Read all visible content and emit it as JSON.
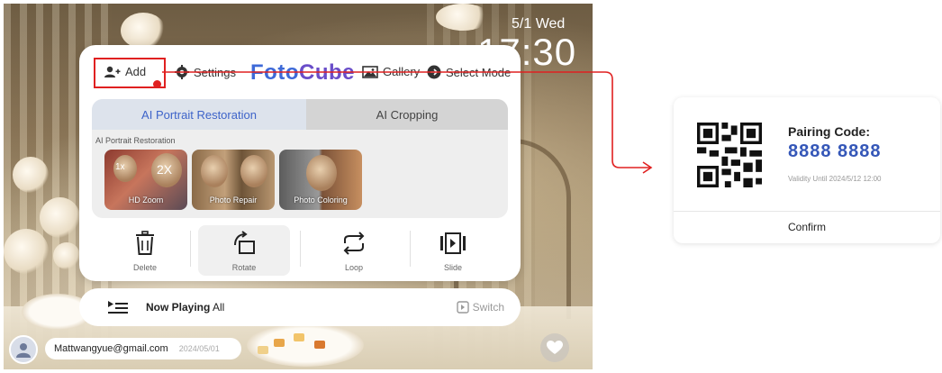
{
  "datetime": {
    "date": "5/1 Wed",
    "time": "17:30"
  },
  "nav": {
    "add_label": "Add",
    "settings_label": "Settings",
    "logo_part1": "Foto",
    "logo_part2": "Cube",
    "gallery_label": "Gallery",
    "select_mode_label": "Select Mode"
  },
  "tabs": [
    {
      "label": "AI Portrait Restoration",
      "active": true
    },
    {
      "label": "AI Cropping",
      "active": false
    }
  ],
  "section_label": "AI Portrait Restoration",
  "features": [
    {
      "label": "HD Zoom",
      "tag_a": "1x",
      "tag_b": "2X"
    },
    {
      "label": "Photo Repair"
    },
    {
      "label": "Photo Coloring"
    }
  ],
  "actions": [
    {
      "label": "Delete",
      "icon": "trash-icon"
    },
    {
      "label": "Rotate",
      "icon": "rotate-icon",
      "selected": true
    },
    {
      "label": "Loop",
      "icon": "loop-icon"
    },
    {
      "label": "Slide",
      "icon": "slide-icon"
    }
  ],
  "now_playing": {
    "prefix": "Now Playing",
    "value": "All",
    "switch_label": "Switch"
  },
  "account": {
    "email": "Mattwangyue@gmail.com",
    "date": "2024/05/01"
  },
  "pairing": {
    "title": "Pairing Code:",
    "code": "8888 8888",
    "validity": "Validity Until 2024/5/12 12:00",
    "confirm_label": "Confirm"
  },
  "colors": {
    "accent": "#3e64c9",
    "highlight": "#e02020",
    "code": "#3557b8"
  }
}
